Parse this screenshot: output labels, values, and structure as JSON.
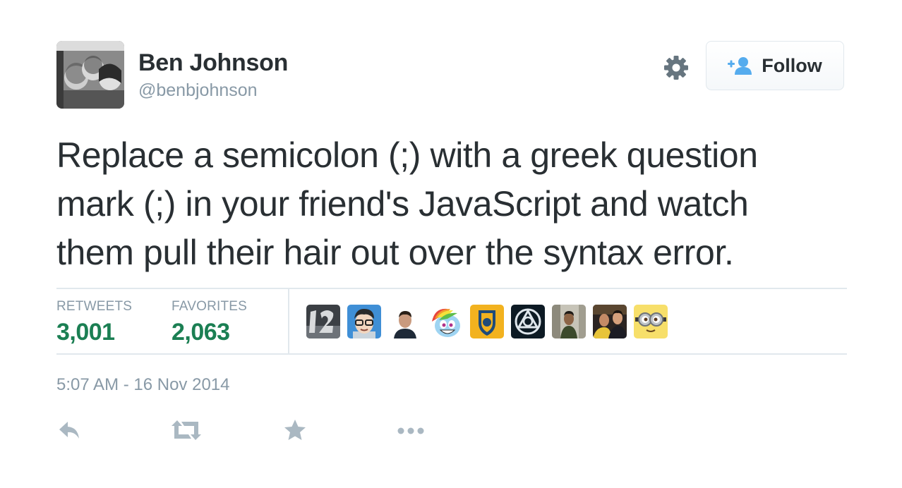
{
  "user": {
    "display_name": "Ben Johnson",
    "handle": "@benbjohnson"
  },
  "follow_button": {
    "label": "Follow"
  },
  "tweet": {
    "lines": [
      "Replace a semicolon (;) with a greek question",
      "mark (;) in your friend's JavaScript and watch",
      "them pull their hair out over the syntax error."
    ]
  },
  "stats": {
    "retweets_label": "RETWEETS",
    "retweets_value": "3,001",
    "favorites_label": "FAVORITES",
    "favorites_value": "2,063"
  },
  "favoriters": [
    "favoriter-avatar-12",
    "favoriter-avatar-cartoon-glasses",
    "favoriter-avatar-man-dark",
    "favoriter-avatar-rainbow-pony",
    "favoriter-avatar-football-club",
    "favoriter-avatar-triangle-logo",
    "favoriter-avatar-man-store",
    "favoriter-avatar-couple",
    "favoriter-avatar-minion"
  ],
  "timestamp": "5:07 AM - 16 Nov 2014",
  "actions": [
    "reply-icon",
    "retweet-icon",
    "favorite-icon",
    "more-icon"
  ],
  "colors": {
    "text": "#292f33",
    "muted": "#8899a6",
    "stat_value": "#1b7f53",
    "follow_icon": "#55acee",
    "divider": "#e1e8ed"
  }
}
